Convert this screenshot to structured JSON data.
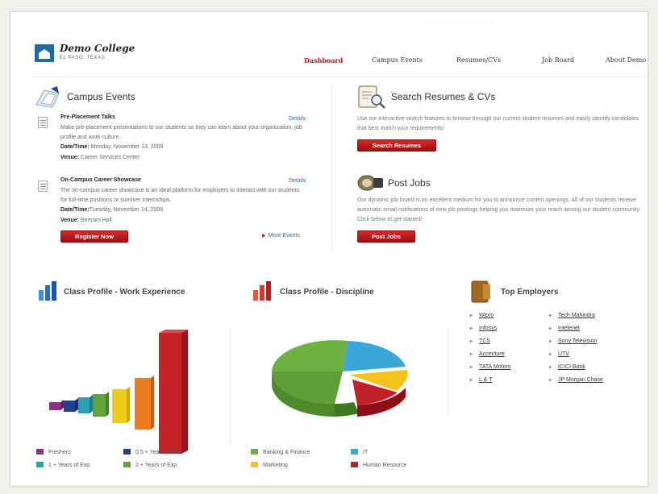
{
  "header": {
    "college_name": "Demo College",
    "college_city": "EL PASO, TEXAS",
    "nav": [
      {
        "label": "Dashboard",
        "active": true
      },
      {
        "label": "Campus Events",
        "active": false
      },
      {
        "label": "Resumes/CVs",
        "active": false
      },
      {
        "label": "Job Board",
        "active": false
      },
      {
        "label": "About Demo",
        "active": false
      }
    ]
  },
  "campus_events": {
    "title": "Campus Events",
    "events": [
      {
        "title": "Pre-Placement Talks",
        "details": "Details",
        "description": "Make pre-placement presentations to our students so they can learn about your organization, job profile and work culture.",
        "date_label": "Date/Time:",
        "date_value": " Monday, November 13, 2009",
        "venue_label": "Venue:",
        "venue_value": " Career Services Center"
      },
      {
        "title": "On-Campus Career Showcase",
        "details": "Details",
        "description": "The on-campus career showcase is an ideal platform for employers to interact with our students for full-time positions or summer internships.",
        "date_label": "Date/Time:",
        "date_value": "Tuesday, November 14, 2009",
        "venue_label": "Venue:",
        "venue_value": " Bertram Hall"
      }
    ],
    "register_button": "Register Now",
    "more_events": "More Events"
  },
  "search_resumes": {
    "title": "Search Resumes & CVs",
    "description": "Use our interactive search features to browse through our current student resumes and easily identify candidates that best match your requirements!",
    "button": "Search Resumes"
  },
  "post_jobs": {
    "title": "Post Jobs",
    "description": "Our dynamic job board is an excellent medium for you to announce current openings. All of our students receive automatic email notifications of new job postings helping you maximize your reach among our student community. Click below to get started!",
    "button": "Post Jobs"
  },
  "work_experience": {
    "title": "Class Profile - Work Experience",
    "legend": [
      {
        "label": "Freshers",
        "color": "#8e2d8a"
      },
      {
        "label": "0.5 + Years of Exp.",
        "color": "#1f3f8f"
      },
      {
        "label": "1 + Years of Exp.",
        "color": "#2aa0b5"
      },
      {
        "label": "2 + Years of Exp.",
        "color": "#62a43a"
      }
    ]
  },
  "discipline": {
    "title": "Class Profile - Discipline",
    "legend": [
      {
        "label": "Banking & Finance",
        "color": "#6fb043"
      },
      {
        "label": "IT",
        "color": "#3ca6d8"
      },
      {
        "label": "Marketing",
        "color": "#f4c21a"
      },
      {
        "label": "Human Resource",
        "color": "#c0202a"
      }
    ]
  },
  "top_employers": {
    "title": "Top Employers",
    "col1": [
      "Wipro",
      "Infosys",
      "TCS",
      "Accenture",
      "TATA Motors",
      "L & T"
    ],
    "col2": [
      "Tech Mahindra",
      "Intelenet",
      "Sony Television",
      "UTV",
      "ICICI Bank",
      "JP Morgan Chase"
    ]
  }
}
